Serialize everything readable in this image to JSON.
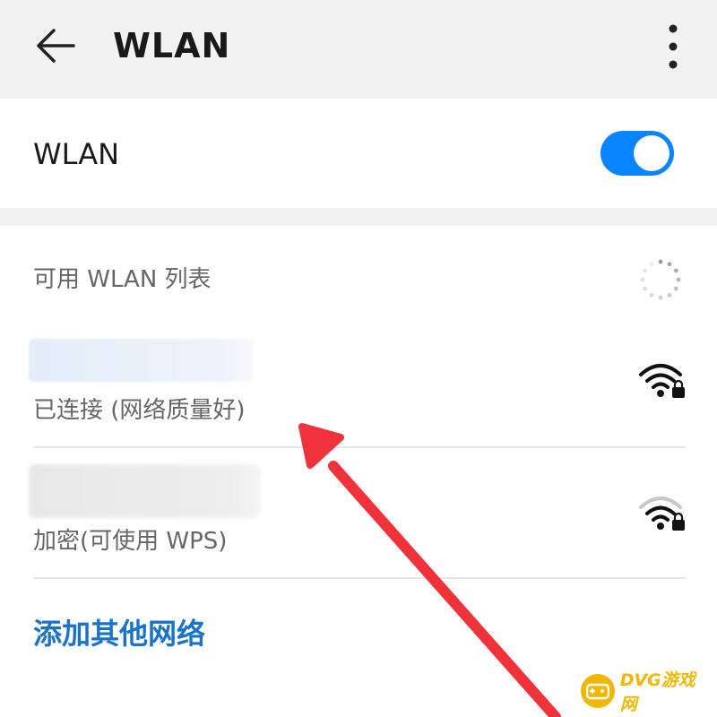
{
  "header": {
    "title": "WLAN",
    "back_icon": "arrow-left-icon",
    "more_icon": "more-vertical-icon"
  },
  "wlan_toggle": {
    "label": "WLAN",
    "on": true,
    "color": "#0a84ff"
  },
  "available": {
    "title": "可用 WLAN 列表",
    "spinner_icon": "loading-spinner-icon"
  },
  "networks": [
    {
      "ssid": "",
      "status": "已连接 (网络质量好)",
      "signal": "strong",
      "locked": true
    },
    {
      "ssid": "",
      "status": "加密(可使用 WPS)",
      "signal": "medium",
      "locked": true
    }
  ],
  "add_network": {
    "label": "添加其他网络",
    "color": "#1a73c8"
  },
  "annotation": {
    "color": "#f0333a"
  },
  "watermark": {
    "text": "DVG游戏网"
  }
}
